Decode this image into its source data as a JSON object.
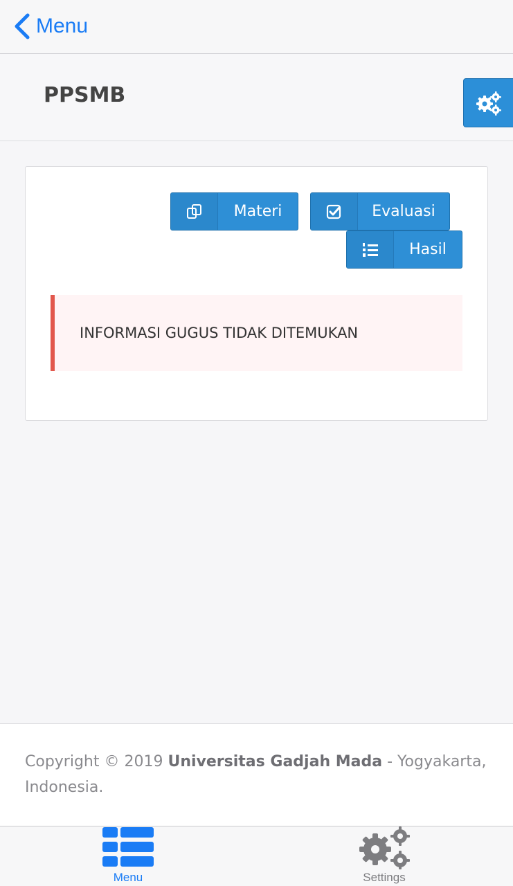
{
  "nav": {
    "back_label": "Menu"
  },
  "header": {
    "title": "PPSMB"
  },
  "panel": {
    "buttons": [
      {
        "label": "Materi",
        "icon": "copy-icon"
      },
      {
        "label": "Evaluasi",
        "icon": "check-square-icon"
      },
      {
        "label": "Hasil",
        "icon": "ordered-list-icon"
      }
    ],
    "alert_text": "INFORMASI GUGUS TIDAK DITEMUKAN"
  },
  "footer": {
    "prefix": "Copyright © 2019 ",
    "org": "Universitas Gadjah Mada",
    "suffix": " - Yogyakarta, Indonesia."
  },
  "tabbar": {
    "tabs": [
      {
        "label": "Menu",
        "icon": "list-icon",
        "active": true
      },
      {
        "label": "Settings",
        "icon": "gears-icon",
        "active": false
      }
    ]
  },
  "colors": {
    "accent": "#1a7cf5",
    "button": "#2e8fd6",
    "alert_border": "#e2574c",
    "alert_bg": "#fff4f5"
  }
}
